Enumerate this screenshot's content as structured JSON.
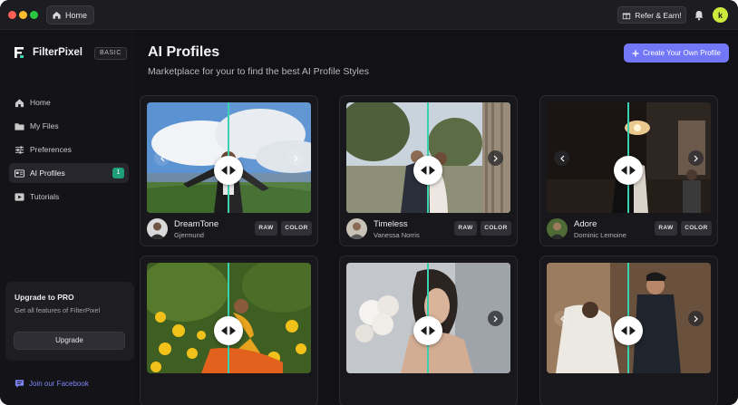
{
  "titlebar": {
    "home_tab": "Home",
    "refer_label": "Refer & Earn!",
    "avatar_initial": "k"
  },
  "sidebar": {
    "brand_name": "FilterPixel",
    "plan_badge": "BASIC",
    "items": [
      {
        "label": "Home",
        "icon": "home-icon"
      },
      {
        "label": "My Files",
        "icon": "folder-icon"
      },
      {
        "label": "Preferences",
        "icon": "sliders-icon"
      },
      {
        "label": "AI Profiles",
        "icon": "profiles-icon",
        "active": true,
        "count": "1"
      },
      {
        "label": "Tutorials",
        "icon": "video-icon"
      }
    ],
    "promo": {
      "title": "Upgrade to PRO",
      "subtitle": "Get all features of FilterPixel",
      "button": "Upgrade"
    },
    "facebook_link": "Join our Facebook"
  },
  "main": {
    "title": "AI Profiles",
    "subtitle": "Marketplace for your to find the best AI Profile Styles",
    "create_button": "Create Your Own Profile",
    "cards": [
      {
        "profile": "DreamTone",
        "creator": "Gjermund",
        "tags": [
          "RAW",
          "COLOR"
        ]
      },
      {
        "profile": "Timeless",
        "creator": "Vanessa Norris",
        "tags": [
          "RAW",
          "COLOR"
        ]
      },
      {
        "profile": "Adore",
        "creator": "Dominic Lemoine",
        "tags": [
          "RAW",
          "COLOR"
        ]
      },
      {
        "profile": "",
        "creator": "",
        "tags": []
      },
      {
        "profile": "",
        "creator": "",
        "tags": []
      },
      {
        "profile": "",
        "creator": "",
        "tags": []
      }
    ]
  },
  "colors": {
    "accent": "#7277f7",
    "compare_line": "#3ad1b0",
    "badge_green": "#1e9e7a",
    "avatar_lime": "#cdea3c"
  }
}
